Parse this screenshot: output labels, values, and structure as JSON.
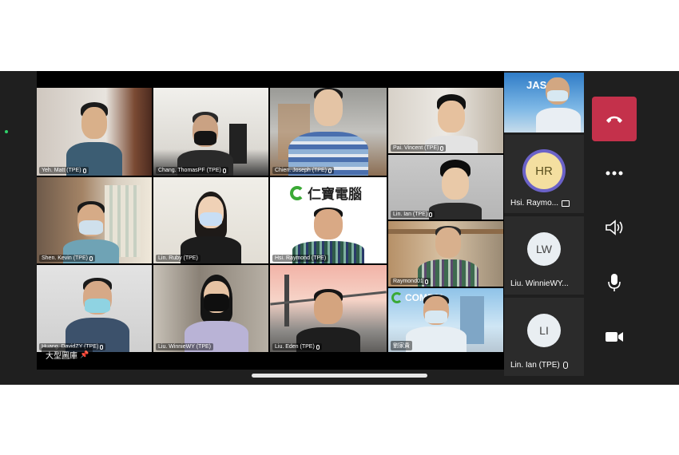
{
  "stage": {
    "tiles": [
      {
        "name": "Yeh. Matt (TPE)"
      },
      {
        "name": "Chang. ThomasPF (TPE)"
      },
      {
        "name": "Chien. Joseph (TPE)"
      },
      {
        "name": "Pai. Vincent (TPE)"
      },
      {
        "name": "Lin. Ian (TPE)"
      },
      {
        "name": "Shen. Kevin (TPE)"
      },
      {
        "name": "Lin. Ruby (TPE)"
      },
      {
        "name": "Hsi. Raymond (TPE)",
        "logo_text": "仁寶電腦"
      },
      {
        "name": "Raymond01"
      },
      {
        "name": "Huang. DavidZY (TPE)"
      },
      {
        "name": "Liu. WinnieWY (TPE)"
      },
      {
        "name": "Liu. Eden (TPE)"
      },
      {
        "name": "劉家貴",
        "logo_text": "COMPAL"
      }
    ],
    "caption": "大型圖庫"
  },
  "sidebar": {
    "self_view_logo": "JAS",
    "participants": [
      {
        "initials": "HR",
        "name": "Hsi. Raymo...",
        "color": "#f4dfa0",
        "ring": "#6b62c8"
      },
      {
        "initials": "LW",
        "name": "Liu. WinnieWY...",
        "color": "#e9eef2"
      },
      {
        "initials": "LI",
        "name": "Lin. Ian (TPE)",
        "color": "#e9eef2"
      }
    ]
  },
  "controls": {
    "items": [
      "hang-up",
      "more",
      "speaker",
      "microphone",
      "camera"
    ]
  },
  "colors": {
    "hangup": "#c4314b",
    "background": "#1f1f1f",
    "compal_green": "#3aa935"
  }
}
